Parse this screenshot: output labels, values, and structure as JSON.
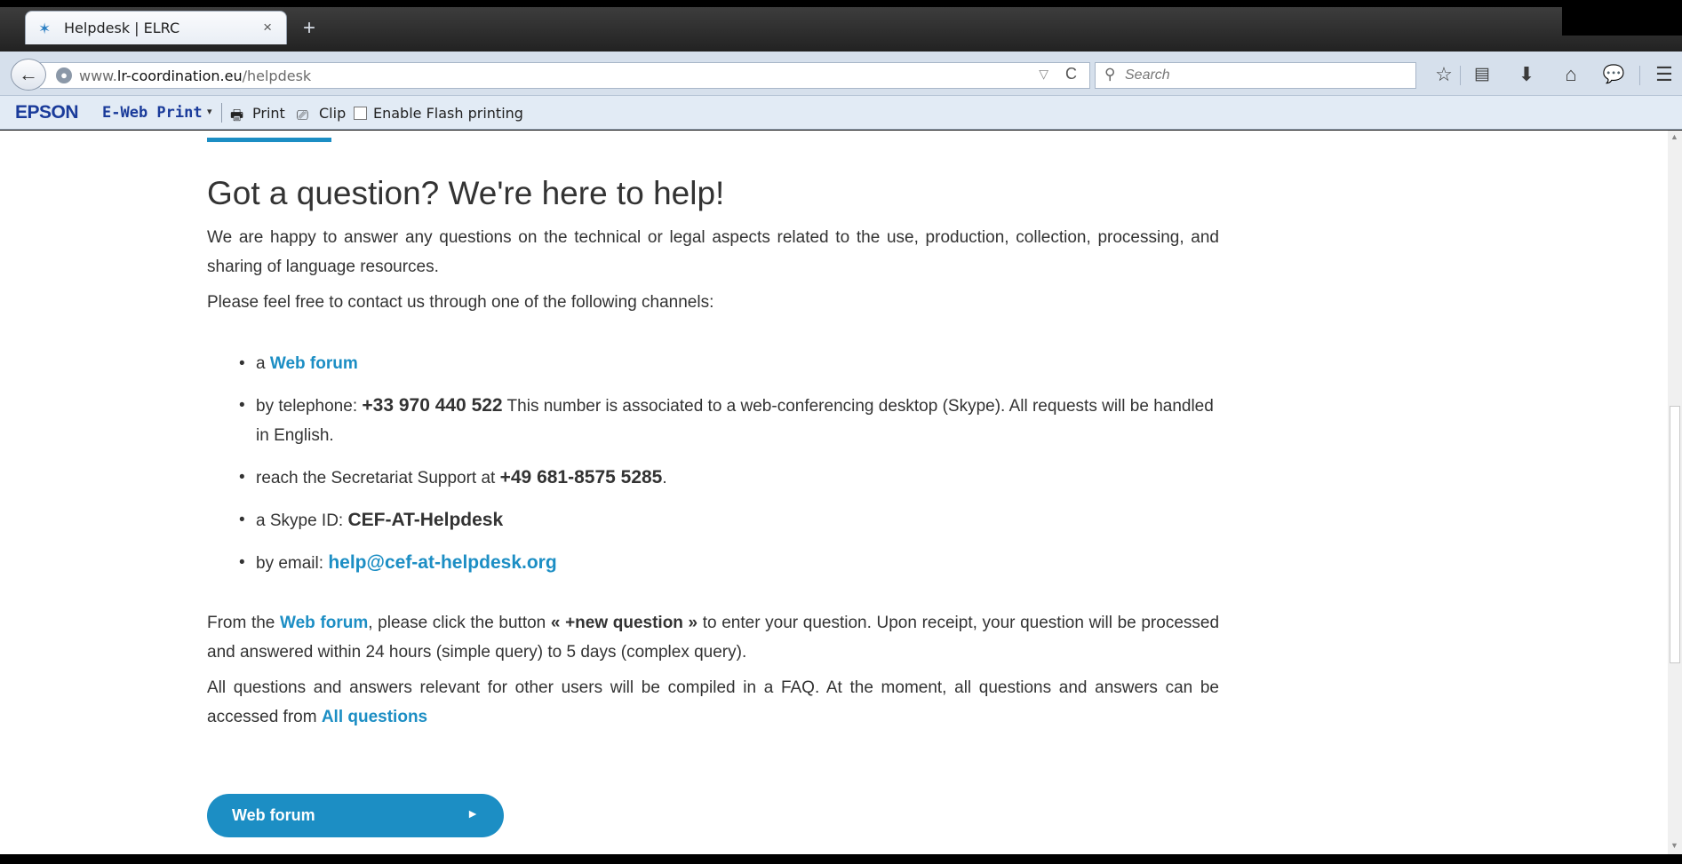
{
  "browser": {
    "tab": {
      "title": "Helpdesk | ELRC",
      "close": "×"
    },
    "new_tab": "+",
    "back": "←",
    "url": {
      "host_prefix": "www.",
      "host": "lr-coordination.eu",
      "path": "/helpdesk"
    },
    "url_dropdown": "▽",
    "reload": "C",
    "search_placeholder": "Search",
    "toolbar_icons": [
      "bookmark-star-icon",
      "reading-list-icon",
      "download-icon",
      "home-icon",
      "chat-icon",
      "menu-icon"
    ]
  },
  "epson": {
    "logo": "EPSON",
    "eweb": "E-Web Print",
    "print": "Print",
    "clip": "Clip",
    "flash": "Enable Flash printing"
  },
  "content": {
    "title": "Got a question? We're here to help!",
    "intro": "We are happy to answer any questions on the technical or legal aspects related to the use, production, collection, processing, and sharing of language resources.",
    "channels_intro": "Please feel free to contact us through one of the following channels:",
    "channels": {
      "forum_prefix": "a ",
      "forum_link": "Web forum",
      "phone_prefix": "by telephone: ",
      "phone_number": "+33 970 440 522",
      "phone_note": " This number is associated to a web-conferencing desktop (Skype). All requests will be handled in English.",
      "secretariat_prefix": "reach the Secretariat Support at ",
      "secretariat_number": "+49 681-8575 5285",
      "secretariat_suffix": ".",
      "skype_prefix": "a Skype ID: ",
      "skype_id": "CEF-AT-Helpdesk",
      "email_prefix": "by email: ",
      "email": "help@cef-at-helpdesk.org"
    },
    "forum_para": {
      "prefix": "From the ",
      "link": "Web forum",
      "mid": ", please click the button ",
      "button_ref": "« +new question »",
      "suffix": " to enter your question. Upon receipt, your question will be processed and answered within 24 hours (simple query) to 5 days (complex query)."
    },
    "faq_para": {
      "text": "All questions and answers relevant for other users will be compiled in a FAQ. At the moment, all questions and answers can be accessed from ",
      "link": "All questions"
    },
    "cta_label": "Web forum",
    "cta_arrow": "►"
  },
  "colors": {
    "accent": "#1c8ec4",
    "text": "#333333",
    "chrome": "#d6e0ec"
  }
}
